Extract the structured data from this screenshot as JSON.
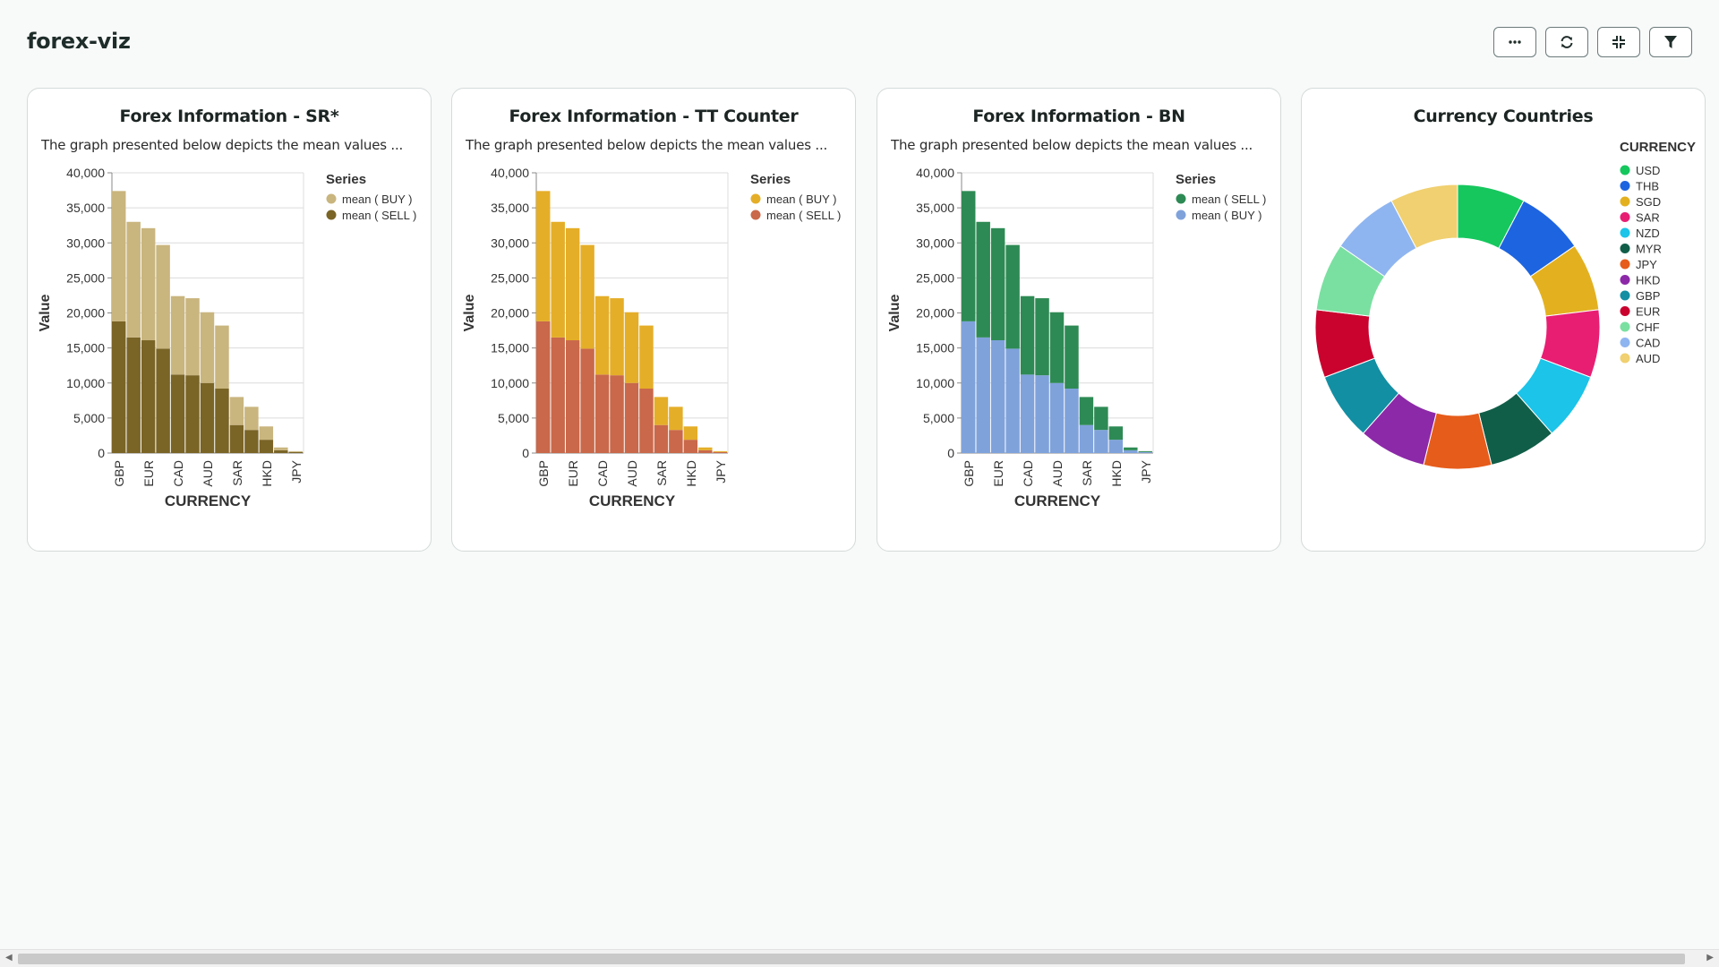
{
  "page": {
    "title": "forex-viz"
  },
  "toolbar": {
    "buttons": [
      {
        "name": "more-options-button",
        "icon": "ellipsis-icon"
      },
      {
        "name": "refresh-button",
        "icon": "refresh-icon"
      },
      {
        "name": "collapse-button",
        "icon": "collapse-icon"
      },
      {
        "name": "filter-button",
        "icon": "filter-icon"
      }
    ]
  },
  "cards": [
    {
      "title": "Forex Information - SR*",
      "description": "The graph presented below depicts the mean values ...",
      "legend_title": "Series"
    },
    {
      "title": "Forex Information - TT Counter",
      "description": "The graph presented below depicts the mean values ...",
      "legend_title": "Series"
    },
    {
      "title": "Forex Information - BN",
      "description": "The graph presented below depicts the mean values ...",
      "legend_title": "Series"
    },
    {
      "title": "Currency Countries",
      "legend_title": "CURRENCY"
    }
  ],
  "chart_data": [
    {
      "type": "bar",
      "stacked": true,
      "title": "Forex Information - SR*",
      "xlabel": "CURRENCY",
      "ylabel": "Value",
      "ylim": [
        0,
        40000
      ],
      "yticks": [
        0,
        5000,
        10000,
        15000,
        20000,
        25000,
        30000,
        35000,
        40000
      ],
      "ytick_labels": [
        "0",
        "5,000",
        "10,000",
        "15,000",
        "20,000",
        "25,000",
        "30,000",
        "35,000",
        "40,000"
      ],
      "categories": [
        "GBP",
        "",
        "EUR",
        "",
        "CAD",
        "",
        "AUD",
        "",
        "SAR",
        "",
        "HKD",
        "",
        "JPY"
      ],
      "legend_title": "Series",
      "legend_placement": "right",
      "series": [
        {
          "name": "mean ( SELL )",
          "color": "#7a6426",
          "values": [
            18800,
            16500,
            16100,
            14900,
            11200,
            11100,
            10000,
            9200,
            4000,
            3300,
            1900,
            400,
            140
          ]
        },
        {
          "name": "mean ( BUY )",
          "color": "#c9b57e",
          "values": [
            18600,
            16500,
            16000,
            14800,
            11200,
            11000,
            10100,
            9000,
            4000,
            3300,
            1900,
            400,
            130
          ]
        }
      ]
    },
    {
      "type": "bar",
      "stacked": true,
      "title": "Forex Information - TT Counter",
      "xlabel": "CURRENCY",
      "ylabel": "Value",
      "ylim": [
        0,
        40000
      ],
      "yticks": [
        0,
        5000,
        10000,
        15000,
        20000,
        25000,
        30000,
        35000,
        40000
      ],
      "ytick_labels": [
        "0",
        "5,000",
        "10,000",
        "15,000",
        "20,000",
        "25,000",
        "30,000",
        "35,000",
        "40,000"
      ],
      "categories": [
        "GBP",
        "",
        "EUR",
        "",
        "CAD",
        "",
        "AUD",
        "",
        "SAR",
        "",
        "HKD",
        "",
        "JPY"
      ],
      "legend_title": "Series",
      "legend_placement": "right",
      "series": [
        {
          "name": "mean ( SELL )",
          "color": "#c9684a",
          "values": [
            18800,
            16500,
            16100,
            14900,
            11200,
            11100,
            10000,
            9200,
            4000,
            3300,
            1900,
            400,
            140
          ]
        },
        {
          "name": "mean ( BUY )",
          "color": "#e5ae28",
          "values": [
            18600,
            16500,
            16000,
            14800,
            11200,
            11000,
            10100,
            9000,
            4000,
            3300,
            1900,
            400,
            130
          ]
        }
      ]
    },
    {
      "type": "bar",
      "stacked": true,
      "title": "Forex Information - BN",
      "xlabel": "CURRENCY",
      "ylabel": "Value",
      "ylim": [
        0,
        40000
      ],
      "yticks": [
        0,
        5000,
        10000,
        15000,
        20000,
        25000,
        30000,
        35000,
        40000
      ],
      "ytick_labels": [
        "0",
        "5,000",
        "10,000",
        "15,000",
        "20,000",
        "25,000",
        "30,000",
        "35,000",
        "40,000"
      ],
      "categories": [
        "GBP",
        "",
        "EUR",
        "",
        "CAD",
        "",
        "AUD",
        "",
        "SAR",
        "",
        "HKD",
        "",
        "JPY"
      ],
      "legend_title": "Series",
      "legend_placement": "right",
      "series": [
        {
          "name": "mean ( BUY )",
          "color": "#7fa2db",
          "values": [
            18800,
            16500,
            16100,
            14900,
            11200,
            11100,
            10000,
            9200,
            4000,
            3300,
            1900,
            400,
            140
          ]
        },
        {
          "name": "mean ( SELL )",
          "color": "#2e8a54",
          "values": [
            18600,
            16500,
            16000,
            14800,
            11200,
            11000,
            10100,
            9000,
            4000,
            3300,
            1900,
            400,
            130
          ]
        }
      ],
      "legend_order": [
        "mean ( SELL )",
        "mean ( BUY )"
      ]
    },
    {
      "type": "pie",
      "donut": true,
      "title": "Currency Countries",
      "legend_title": "CURRENCY",
      "legend_placement": "right",
      "slices": [
        {
          "label": "USD",
          "value": 1,
          "color": "#16c75e"
        },
        {
          "label": "THB",
          "value": 1,
          "color": "#1d64e0"
        },
        {
          "label": "SGD",
          "value": 1,
          "color": "#e3b120"
        },
        {
          "label": "SAR",
          "value": 1,
          "color": "#e81e73"
        },
        {
          "label": "NZD",
          "value": 1,
          "color": "#1bc4e8"
        },
        {
          "label": "MYR",
          "value": 1,
          "color": "#115e48"
        },
        {
          "label": "JPY",
          "value": 1,
          "color": "#e65c1b"
        },
        {
          "label": "HKD",
          "value": 1,
          "color": "#8c29a8"
        },
        {
          "label": "GBP",
          "value": 1,
          "color": "#138fa3"
        },
        {
          "label": "EUR",
          "value": 1,
          "color": "#c9022e"
        },
        {
          "label": "CHF",
          "value": 1,
          "color": "#7ae0a1"
        },
        {
          "label": "CAD",
          "value": 1,
          "color": "#8fb5f0"
        },
        {
          "label": "AUD",
          "value": 1,
          "color": "#f0d070"
        }
      ]
    }
  ]
}
